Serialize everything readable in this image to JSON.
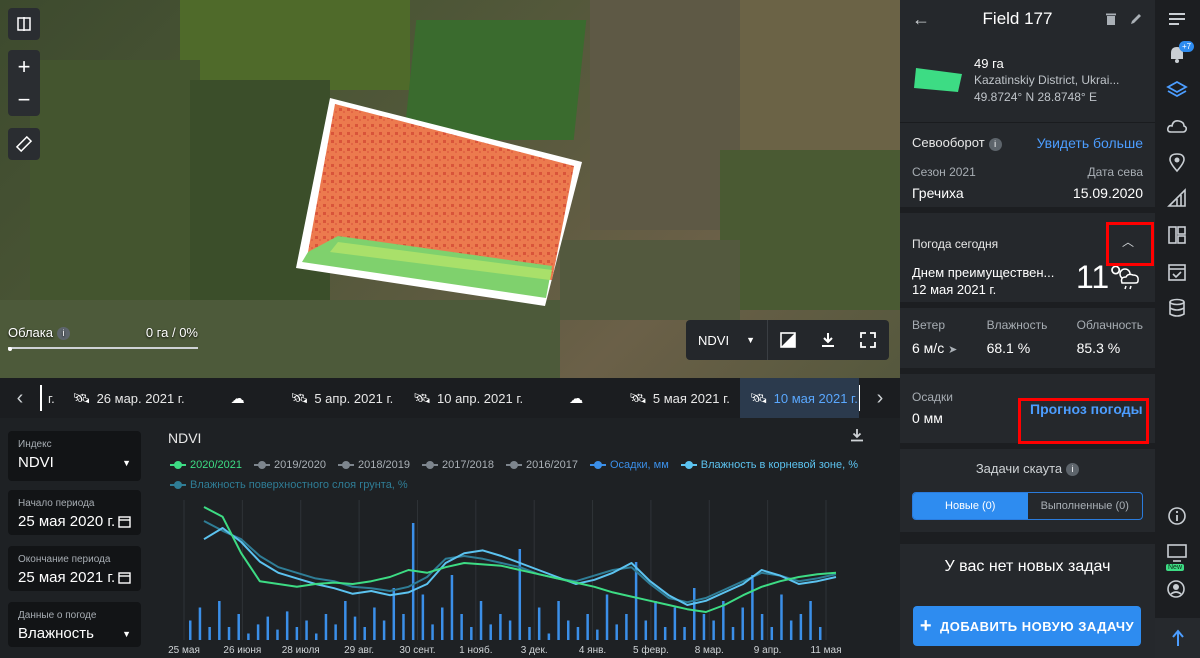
{
  "map": {
    "clouds_label": "Облака",
    "clouds_value": "0 га / 0%",
    "zoom_in": "+",
    "zoom_out": "−",
    "layer_index": "NDVI"
  },
  "timeline": {
    "items": [
      {
        "label": "г.",
        "type": "partial"
      },
      {
        "label": "26 мар. 2021 г.",
        "type": "satellite"
      },
      {
        "label": "",
        "type": "cloud"
      },
      {
        "label": "5 апр. 2021 г.",
        "type": "satellite"
      },
      {
        "label": "10 апр. 2021 г.",
        "type": "satellite"
      },
      {
        "label": "",
        "type": "cloud"
      },
      {
        "label": "5 мая 2021 г.",
        "type": "satellite"
      },
      {
        "label": "10 мая 2021 г.",
        "type": "satellite",
        "active": true
      }
    ]
  },
  "filters": {
    "index_label": "Индекс",
    "index_value": "NDVI",
    "start_label": "Начало периода",
    "start_value": "25 мая 2020 г.",
    "end_label": "Окончание периода",
    "end_value": "25 мая 2021 г.",
    "weather_label": "Данные о погоде",
    "weather_value": "Влажность"
  },
  "chart_data": {
    "type": "line",
    "title": "NDVI",
    "legend": [
      {
        "name": "2020/2021",
        "color": "#3ddc84"
      },
      {
        "name": "2019/2020",
        "color": "#7d858d"
      },
      {
        "name": "2018/2019",
        "color": "#7d858d"
      },
      {
        "name": "2017/2018",
        "color": "#7d858d"
      },
      {
        "name": "2016/2017",
        "color": "#7d858d"
      },
      {
        "name": "Осадки, мм",
        "color": "#3b8fe8"
      },
      {
        "name": "Влажность в корневой зоне, %",
        "color": "#5cc3f0"
      },
      {
        "name": "Влажность поверхностного слоя грунта, %",
        "color": "#2f7d96"
      }
    ],
    "x_tick_labels": [
      "25 мая",
      "26 июня",
      "28 июля",
      "29 авг.",
      "30 сент.",
      "1 нояб.",
      "3 дек.",
      "4 янв.",
      "5 февр.",
      "8 мар.",
      "9 апр.",
      "11 мая"
    ],
    "series": [
      {
        "name": "2020/2021",
        "values": [
          0.95,
          0.88,
          0.62,
          0.42,
          0.4,
          0.38,
          0.4,
          0.41,
          0.4,
          0.42,
          0.45,
          0.5,
          0.48,
          0.52,
          0.55,
          0.54,
          0.53,
          0.5,
          0.47,
          0.44,
          0.41,
          0.38,
          0.34,
          0.31,
          0.28,
          0.25,
          0.22,
          0.2,
          0.25,
          0.32,
          0.38,
          0.42,
          0.45,
          0.47,
          0.48
        ]
      },
      {
        "name": "Влажность в корневой зоне, %",
        "values": [
          0.72,
          0.8,
          0.7,
          0.56,
          0.48,
          0.44,
          0.4,
          0.37,
          0.33,
          0.35,
          0.32,
          0.34,
          0.4,
          0.55,
          0.62,
          0.64,
          0.6,
          0.55,
          0.5,
          0.45,
          0.4,
          0.43,
          0.48,
          0.55,
          0.42,
          0.32,
          0.25,
          0.28,
          0.34,
          0.4,
          0.5,
          0.46,
          0.4,
          0.42,
          0.45
        ]
      },
      {
        "name": "Влажность поверхностного слоя грунта, %",
        "values": [
          0.85,
          0.78,
          0.72,
          0.6,
          0.52,
          0.48,
          0.44,
          0.42,
          0.38,
          0.37,
          0.35,
          0.38,
          0.45,
          0.58,
          0.6,
          0.58,
          0.55,
          0.52,
          0.47,
          0.44,
          0.42,
          0.46,
          0.5,
          0.52,
          0.4,
          0.3,
          0.27,
          0.3,
          0.36,
          0.42,
          0.48,
          0.46,
          0.42,
          0.44,
          0.47
        ]
      }
    ],
    "precipitation_relative": [
      0.15,
      0.25,
      0.1,
      0.3,
      0.1,
      0.2,
      0.05,
      0.12,
      0.18,
      0.08,
      0.22,
      0.1,
      0.15,
      0.05,
      0.2,
      0.12,
      0.3,
      0.18,
      0.1,
      0.25,
      0.15,
      0.4,
      0.2,
      0.9,
      0.35,
      0.12,
      0.25,
      0.5,
      0.2,
      0.1,
      0.3,
      0.12,
      0.2,
      0.15,
      0.7,
      0.1,
      0.25,
      0.05,
      0.3,
      0.15,
      0.1,
      0.2,
      0.08,
      0.35,
      0.12,
      0.2,
      0.6,
      0.15,
      0.3,
      0.1,
      0.25,
      0.1,
      0.4,
      0.2,
      0.15,
      0.3,
      0.1,
      0.25,
      0.5,
      0.2,
      0.1,
      0.35,
      0.15,
      0.2,
      0.3,
      0.1
    ]
  },
  "panel": {
    "title": "Field 177",
    "area": "49 га",
    "location": "Kazatinskiy District, Ukrai...",
    "coords": "49.8724° N 28.8748° E",
    "rotation_label": "Севооборот",
    "see_more": "Увидеть больше",
    "season_label": "Сезон 2021",
    "season_value": "Гречиха",
    "sowing_label": "Дата сева",
    "sowing_value": "15.09.2020",
    "weather_title": "Погода сегодня",
    "weather_desc": "Днем преимуществен...",
    "weather_date": "12 мая 2021 г.",
    "temperature": "11°",
    "wind_label": "Ветер",
    "wind_value": "6 м/с",
    "humidity_label": "Влажность",
    "humidity_value": "68.1 %",
    "cloud_label": "Облачность",
    "cloud_value": "85.3 %",
    "precip_label": "Осадки",
    "precip_value": "0 мм",
    "forecast_link": "Прогноз погоды",
    "scout_title": "Задачи скаута",
    "tab_new": "Новые (0)",
    "tab_done": "Выполненные (0)",
    "no_tasks": "У вас нет новых задач",
    "add_task": "ДОБАВИТЬ НОВУЮ ЗАДАЧУ"
  },
  "rail": {
    "notif_count": "+7",
    "new_badge": "New"
  },
  "colors": {
    "accent": "#2e8cf0",
    "link": "#4c9dff",
    "highlight": "#ff0000",
    "field": "#3ddc84"
  }
}
